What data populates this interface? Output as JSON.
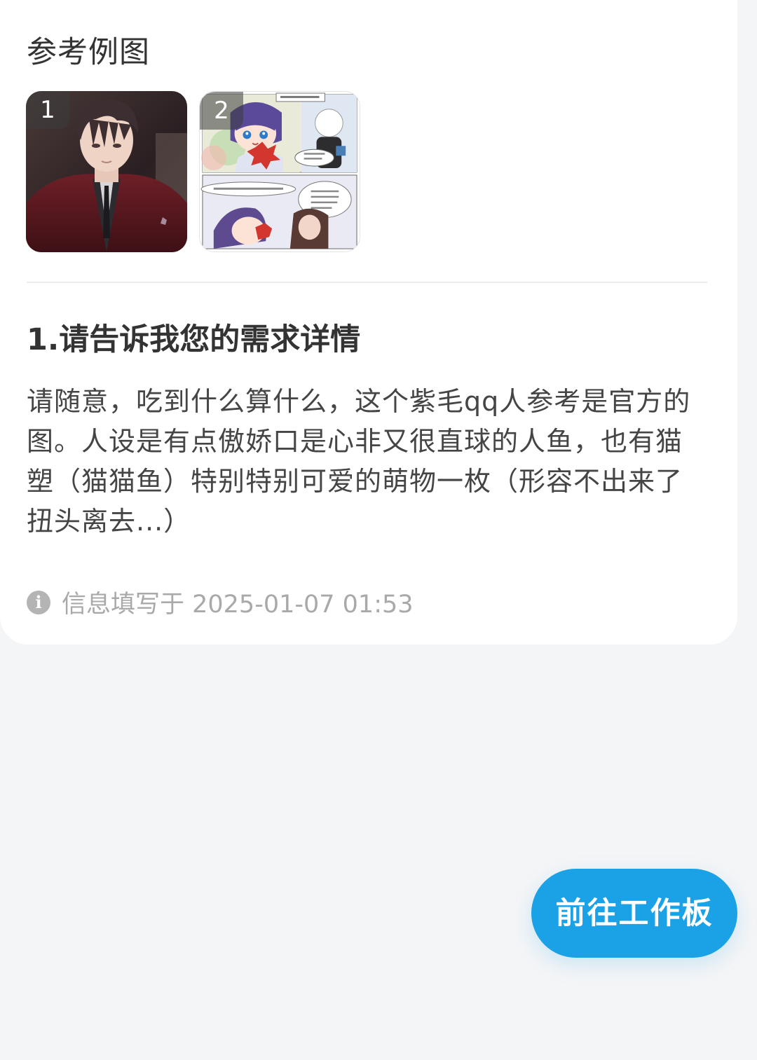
{
  "section": {
    "title": "参考例图"
  },
  "thumbnails": [
    {
      "index": "1",
      "description_icon": "portrait-image"
    },
    {
      "index": "2",
      "description_icon": "comic-image"
    }
  ],
  "question": {
    "title": "1.请告诉我您的需求详情",
    "answer": "请随意，吃到什么算什么，这个紫毛qq人参考是官方的图。人设是有点傲娇口是心非又很直球的人鱼，也有猫塑（猫猫鱼）特别特别可爱的萌物一枚（形容不出来了扭头离去...）"
  },
  "meta": {
    "icon": "info-icon",
    "label": "信息填写于 2025-01-07 01:53"
  },
  "cta": {
    "label": "前往工作板",
    "color": "#1aa1e6"
  }
}
